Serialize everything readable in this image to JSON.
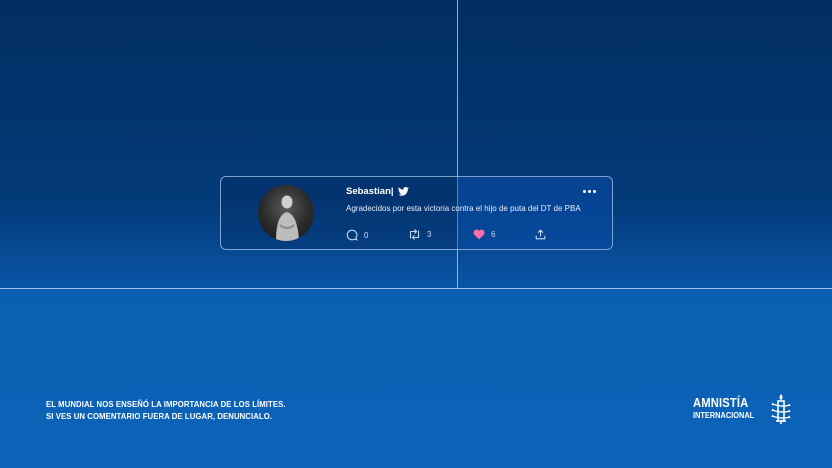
{
  "tweet": {
    "username": "Sebastian|",
    "text": "Agradecidos por esta victoria contra el hijo de puta del DT de PBA",
    "replies": "0",
    "retweets": "3",
    "likes": "6",
    "icons": [
      "twitter-bird-icon",
      "more-options-icon",
      "reply-icon",
      "retweet-icon",
      "heart-icon",
      "share-icon"
    ],
    "colors": {
      "like": "#ff6fa6",
      "text": "#e6eefb"
    }
  },
  "campaign": {
    "slogan_line1": "EL MUNDIAL NOS ENSEÑÓ LA IMPORTANCIA DE LOS LÍMITES.",
    "slogan_line2": "SI VES UN COMENTARIO FUERA DE LUGAR, DENUNCIALO."
  },
  "logo": {
    "name_line1": "AMNISTÍA",
    "name_line2": "INTERNACIONAL",
    "icon": "candle-barbed-wire-icon"
  },
  "colors": {
    "background_top": "#022e61",
    "background_bottom": "#0d63b8",
    "field_lines": "#cde1ff"
  }
}
